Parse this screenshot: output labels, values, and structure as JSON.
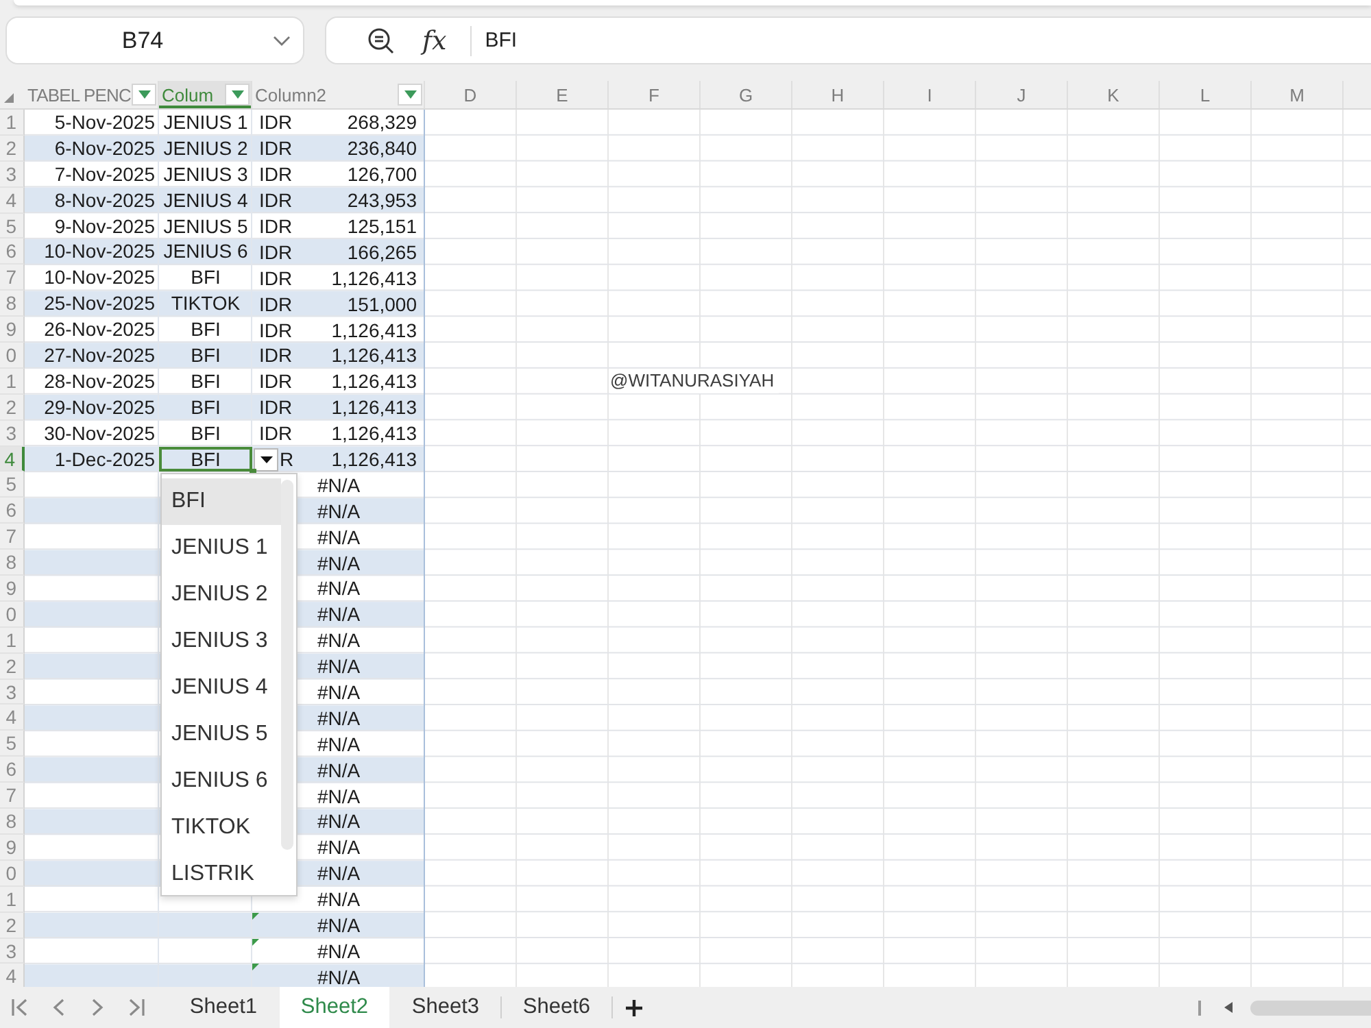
{
  "name_box": {
    "value": "B74"
  },
  "formula_bar": {
    "function_label": "fx",
    "value": "BFI"
  },
  "columns": [
    {
      "label": "TABEL PENC",
      "filter": true,
      "selected": false
    },
    {
      "label": "Colum",
      "filter": true,
      "selected": true
    },
    {
      "label": "Column2",
      "filter": true,
      "selected": false
    },
    {
      "label": "D",
      "filter": false,
      "selected": false
    },
    {
      "label": "E",
      "filter": false,
      "selected": false
    },
    {
      "label": "F",
      "filter": false,
      "selected": false
    },
    {
      "label": "G",
      "filter": false,
      "selected": false
    },
    {
      "label": "H",
      "filter": false,
      "selected": false
    },
    {
      "label": "I",
      "filter": false,
      "selected": false
    },
    {
      "label": "J",
      "filter": false,
      "selected": false
    },
    {
      "label": "K",
      "filter": false,
      "selected": false
    },
    {
      "label": "L",
      "filter": false,
      "selected": false
    },
    {
      "label": "M",
      "filter": false,
      "selected": false
    }
  ],
  "rows": [
    {
      "row_header": "1",
      "selected": false,
      "date": "5-Nov-2025",
      "item": "JENIUS 1",
      "currency": "IDR",
      "amount": "268,329",
      "error_flag": false
    },
    {
      "row_header": "2",
      "selected": false,
      "date": "6-Nov-2025",
      "item": "JENIUS 2",
      "currency": "IDR",
      "amount": "236,840",
      "error_flag": false
    },
    {
      "row_header": "3",
      "selected": false,
      "date": "7-Nov-2025",
      "item": "JENIUS 3",
      "currency": "IDR",
      "amount": "126,700",
      "error_flag": false
    },
    {
      "row_header": "4",
      "selected": false,
      "date": "8-Nov-2025",
      "item": "JENIUS 4",
      "currency": "IDR",
      "amount": "243,953",
      "error_flag": false
    },
    {
      "row_header": "5",
      "selected": false,
      "date": "9-Nov-2025",
      "item": "JENIUS 5",
      "currency": "IDR",
      "amount": "125,151",
      "error_flag": false
    },
    {
      "row_header": "6",
      "selected": false,
      "date": "10-Nov-2025",
      "item": "JENIUS 6",
      "currency": "IDR",
      "amount": "166,265",
      "error_flag": false
    },
    {
      "row_header": "7",
      "selected": false,
      "date": "10-Nov-2025",
      "item": "BFI",
      "currency": "IDR",
      "amount": "1,126,413",
      "error_flag": false
    },
    {
      "row_header": "8",
      "selected": false,
      "date": "25-Nov-2025",
      "item": "TIKTOK",
      "currency": "IDR",
      "amount": "151,000",
      "error_flag": false
    },
    {
      "row_header": "9",
      "selected": false,
      "date": "26-Nov-2025",
      "item": "BFI",
      "currency": "IDR",
      "amount": "1,126,413",
      "error_flag": false
    },
    {
      "row_header": "0",
      "selected": false,
      "date": "27-Nov-2025",
      "item": "BFI",
      "currency": "IDR",
      "amount": "1,126,413",
      "error_flag": false
    },
    {
      "row_header": "1",
      "selected": false,
      "date": "28-Nov-2025",
      "item": "BFI",
      "currency": "IDR",
      "amount": "1,126,413",
      "error_flag": false,
      "note": "@WITANURASIYAH"
    },
    {
      "row_header": "2",
      "selected": false,
      "date": "29-Nov-2025",
      "item": "BFI",
      "currency": "IDR",
      "amount": "1,126,413",
      "error_flag": false
    },
    {
      "row_header": "3",
      "selected": false,
      "date": "30-Nov-2025",
      "item": "BFI",
      "currency": "IDR",
      "amount": "1,126,413",
      "error_flag": false
    },
    {
      "row_header": "4",
      "selected": true,
      "date": "1-Dec-2025",
      "item": "BFI",
      "currency": "R",
      "amount": "1,126,413",
      "error_flag": false
    },
    {
      "row_header": "5",
      "selected": false,
      "result": "#N/A",
      "error_flag": false
    },
    {
      "row_header": "6",
      "selected": false,
      "result": "#N/A",
      "error_flag": false
    },
    {
      "row_header": "7",
      "selected": false,
      "result": "#N/A",
      "error_flag": false
    },
    {
      "row_header": "8",
      "selected": false,
      "result": "#N/A",
      "error_flag": false
    },
    {
      "row_header": "9",
      "selected": false,
      "result": "#N/A",
      "error_flag": false
    },
    {
      "row_header": "0",
      "selected": false,
      "result": "#N/A",
      "error_flag": false
    },
    {
      "row_header": "1",
      "selected": false,
      "result": "#N/A",
      "error_flag": false
    },
    {
      "row_header": "2",
      "selected": false,
      "result": "#N/A",
      "error_flag": false
    },
    {
      "row_header": "3",
      "selected": false,
      "result": "#N/A",
      "error_flag": false
    },
    {
      "row_header": "4",
      "selected": false,
      "result": "#N/A",
      "error_flag": false
    },
    {
      "row_header": "5",
      "selected": false,
      "result": "#N/A",
      "error_flag": false
    },
    {
      "row_header": "6",
      "selected": false,
      "result": "#N/A",
      "error_flag": false
    },
    {
      "row_header": "7",
      "selected": false,
      "result": "#N/A",
      "error_flag": false
    },
    {
      "row_header": "8",
      "selected": false,
      "result": "#N/A",
      "error_flag": false
    },
    {
      "row_header": "9",
      "selected": false,
      "result": "#N/A",
      "error_flag": false
    },
    {
      "row_header": "0",
      "selected": false,
      "result": "#N/A",
      "error_flag": false
    },
    {
      "row_header": "1",
      "selected": false,
      "result": "#N/A",
      "error_flag": false
    },
    {
      "row_header": "2",
      "selected": false,
      "result": "#N/A",
      "error_flag": true
    },
    {
      "row_header": "3",
      "selected": false,
      "result": "#N/A",
      "error_flag": true
    },
    {
      "row_header": "4",
      "selected": false,
      "result": "#N/A",
      "error_flag": true
    }
  ],
  "dropdown": {
    "items": [
      {
        "label": "BFI",
        "selected": true
      },
      {
        "label": "JENIUS 1",
        "selected": false
      },
      {
        "label": "JENIUS 2",
        "selected": false
      },
      {
        "label": "JENIUS 3",
        "selected": false
      },
      {
        "label": "JENIUS 4",
        "selected": false
      },
      {
        "label": "JENIUS 5",
        "selected": false
      },
      {
        "label": "JENIUS 6",
        "selected": false
      },
      {
        "label": "TIKTOK",
        "selected": false
      },
      {
        "label": "LISTRIK",
        "selected": false
      }
    ]
  },
  "sheet_tabs": [
    {
      "label": "Sheet1",
      "selected": false
    },
    {
      "label": "Sheet2",
      "selected": true
    },
    {
      "label": "Sheet3",
      "selected": false
    },
    {
      "label": "Sheet6",
      "selected": false
    }
  ]
}
